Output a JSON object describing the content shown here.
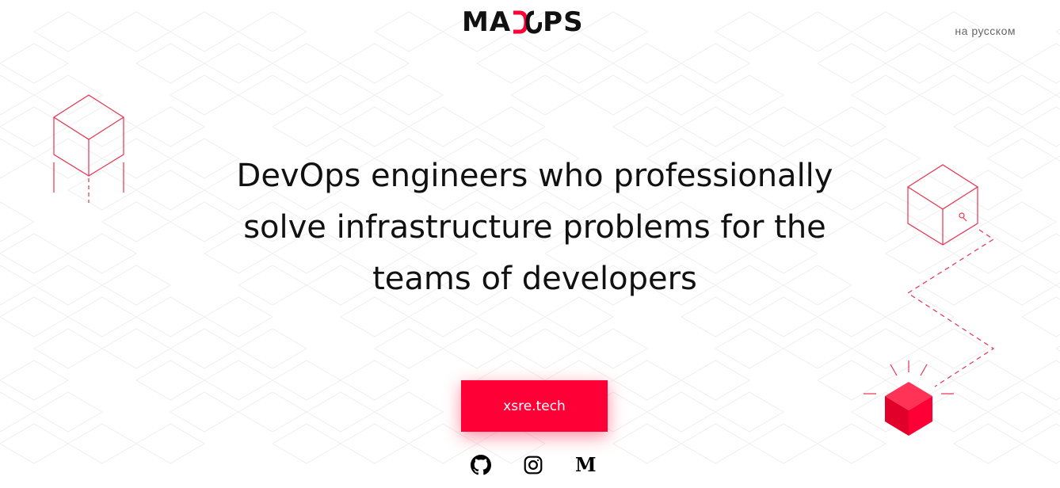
{
  "header": {
    "logo_left": "MA",
    "logo_right": "PS",
    "language_link": "на русском"
  },
  "hero": {
    "headline": "DevOps engineers who professionally solve infrastructure problems for the teams of developers",
    "cta_label": "xsre.tech"
  },
  "social": {
    "icons": [
      "github-icon",
      "instagram-icon",
      "medium-icon"
    ],
    "medium_glyph": "M"
  },
  "colors": {
    "accent": "#ff0036",
    "text": "#111111",
    "grid": "#f0f0f0"
  }
}
